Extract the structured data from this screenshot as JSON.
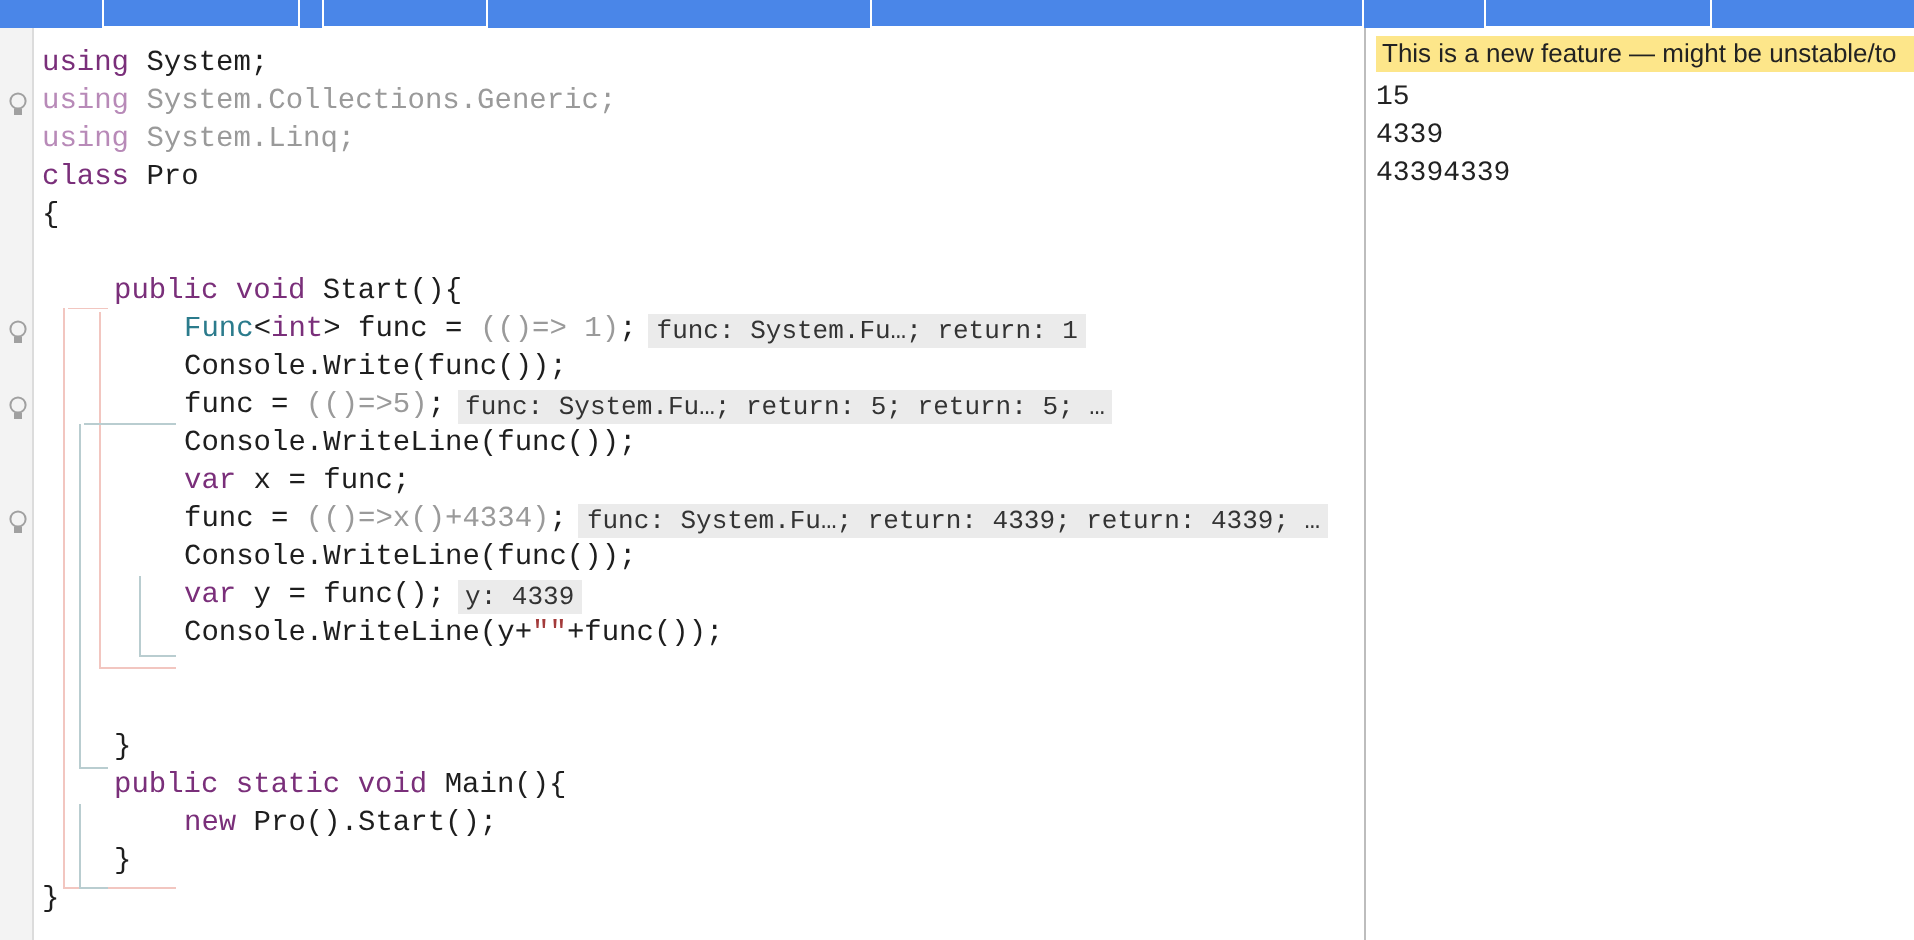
{
  "editor": {
    "lines": [
      {
        "kind": "code",
        "bulb": false,
        "tokens": [
          {
            "kind": "kw",
            "text": "using"
          },
          {
            "kind": "plain",
            "text": " System;"
          }
        ]
      },
      {
        "kind": "code",
        "bulb": true,
        "tokens": [
          {
            "kind": "kw-faded",
            "text": "using"
          },
          {
            "kind": "faded",
            "text": " System.Collections.Generic;"
          }
        ]
      },
      {
        "kind": "code",
        "bulb": false,
        "tokens": [
          {
            "kind": "kw-faded",
            "text": "using"
          },
          {
            "kind": "faded",
            "text": " System.Linq;"
          }
        ]
      },
      {
        "kind": "code",
        "bulb": false,
        "tokens": [
          {
            "kind": "kw",
            "text": "class"
          },
          {
            "kind": "plain",
            "text": " Pro"
          }
        ]
      },
      {
        "kind": "code",
        "bulb": false,
        "tokens": [
          {
            "kind": "plain",
            "text": "{"
          }
        ],
        "children": [
          {
            "kind": "blank",
            "bulb": false
          },
          {
            "kind": "code",
            "bulb": false,
            "tokens": [
              {
                "kind": "kw",
                "text": "public void"
              },
              {
                "kind": "plain",
                "text": " Start(){"
              }
            ],
            "children": [
              {
                "kind": "code",
                "bulb": true,
                "tokens": [
                  {
                    "kind": "type",
                    "text": "Func"
                  },
                  {
                    "kind": "plain",
                    "text": "<"
                  },
                  {
                    "kind": "kw",
                    "text": "int"
                  },
                  {
                    "kind": "plain",
                    "text": "> func = "
                  },
                  {
                    "kind": "faded",
                    "text": "(()=> 1)"
                  },
                  {
                    "kind": "plain",
                    "text": ";"
                  },
                  {
                    "kind": "hint",
                    "text": "func: System.Fu…; return: 1"
                  }
                ]
              },
              {
                "kind": "code",
                "bulb": false,
                "tokens": [
                  {
                    "kind": "plain",
                    "text": "Console.Write(func());"
                  }
                ]
              },
              {
                "kind": "code",
                "bulb": true,
                "tokens": [
                  {
                    "kind": "plain",
                    "text": "func = "
                  },
                  {
                    "kind": "faded",
                    "text": "(()=>5)"
                  },
                  {
                    "kind": "plain",
                    "text": ";"
                  },
                  {
                    "kind": "hint",
                    "text": "func: System.Fu…; return: 5; return: 5; …"
                  }
                ]
              },
              {
                "kind": "code",
                "bulb": false,
                "tokens": [
                  {
                    "kind": "plain",
                    "text": "Console.WriteLine(func());"
                  }
                ]
              },
              {
                "kind": "code",
                "bulb": false,
                "tokens": [
                  {
                    "kind": "kw",
                    "text": "var"
                  },
                  {
                    "kind": "plain",
                    "text": " x = func;"
                  }
                ]
              },
              {
                "kind": "code",
                "bulb": true,
                "tokens": [
                  {
                    "kind": "plain",
                    "text": "func = "
                  },
                  {
                    "kind": "faded",
                    "text": "(()=>x()+4334)"
                  },
                  {
                    "kind": "plain",
                    "text": ";"
                  },
                  {
                    "kind": "hint",
                    "text": "func: System.Fu…; return: 4339; return: 4339; …"
                  }
                ]
              },
              {
                "kind": "code",
                "bulb": false,
                "tokens": [
                  {
                    "kind": "plain",
                    "text": "Console.WriteLine(func());"
                  }
                ]
              },
              {
                "kind": "code",
                "bulb": false,
                "tokens": [
                  {
                    "kind": "kw",
                    "text": "var"
                  },
                  {
                    "kind": "plain",
                    "text": " y = func();"
                  },
                  {
                    "kind": "hint",
                    "text": "y: 4339"
                  }
                ]
              },
              {
                "kind": "code",
                "bulb": false,
                "tokens": [
                  {
                    "kind": "plain",
                    "text": "Console.WriteLine(y+"
                  },
                  {
                    "kind": "string",
                    "text": "\"\""
                  },
                  {
                    "kind": "plain",
                    "text": "+func());"
                  }
                ]
              },
              {
                "kind": "blank",
                "bulb": false
              },
              {
                "kind": "blank",
                "bulb": false
              }
            ]
          },
          {
            "kind": "code",
            "bulb": false,
            "tokens": [
              {
                "kind": "plain",
                "text": "}"
              }
            ]
          },
          {
            "kind": "code",
            "bulb": false,
            "tokens": [
              {
                "kind": "kw",
                "text": "public static void"
              },
              {
                "kind": "plain",
                "text": " Main(){"
              }
            ],
            "children": [
              {
                "kind": "code",
                "bulb": false,
                "tokens": [
                  {
                    "kind": "kw",
                    "text": "new"
                  },
                  {
                    "kind": "plain",
                    "text": " Pro().Start();"
                  }
                ]
              }
            ]
          },
          {
            "kind": "code",
            "bulb": false,
            "tokens": [
              {
                "kind": "plain",
                "text": "}"
              }
            ]
          }
        ]
      },
      {
        "kind": "code",
        "bulb": false,
        "tokens": [
          {
            "kind": "plain",
            "text": "}"
          }
        ]
      }
    ]
  },
  "results": {
    "notice": "This is a new feature — might be unstable/to",
    "output": [
      "15",
      "4339",
      "43394339"
    ]
  }
}
